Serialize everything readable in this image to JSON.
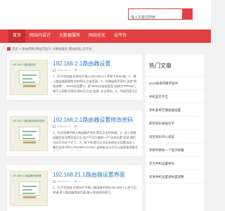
{
  "header": {
    "search_placeholder": "输入关键词搜索"
  },
  "nav": {
    "items": [
      {
        "label": "首页",
        "active": true
      },
      {
        "label": "网站内设计",
        "active": false
      },
      {
        "label": "大数据服务",
        "active": false
      },
      {
        "label": "网站优化",
        "active": false
      },
      {
        "label": "云平台",
        "active": false
      }
    ]
  },
  "breadcrumb": {
    "text": "首页 > 路由网络,网站内设计,大数据服务,网站优化,云平台"
  },
  "articles": [
    {
      "thumb_title": "192.168.2.1路由器设置",
      "title": "192.168.2.1路由器设置",
      "date": "2023-02-17",
      "views": "2",
      "excerpt": "1、打开浏览器,在地址栏输入192.168.2.1,并按下Enter键。2、输入路由器管理账号和密码,点击登录。3、在弹出的页面中,选定\"网络参数\"→\"WAN口设置\"4、把\"WAN口连接类型\"选择为\"PPPoE\"。填写上网账号密码,保存后点击\"连接\",点击保存。5、完成后即可正常使用。"
    },
    {
      "thumb_title": "192.168.2.1路由器设置修改密码",
      "title": "192.168.2.1路由器设置修改密码",
      "date": "2023-02-17",
      "views": "2",
      "excerpt": "1、在浏览器中输入路由器IP地址,然后点击回车键。2、进入到路由器后台设置页面之后,用户们可以看到一个\"无线设置\"选项,我们可以打开这个它了。3、接下来,就可以点击无线安全设置选项,4、最后选择\"WPA-PSK/WPA2-PSK\",这种安全方式可以加密很多数字密码,5、点击保存即可。"
    },
    {
      "thumb_title": "192.168.21.1路由器设置界面",
      "title": "192.168.21.1路由器设置界面",
      "date": "2023-02-17",
      "views": "2",
      "excerpt": "1、打开浏览器,在地址栏中输入路由器IP地址192.168.1.1,按下回车键,进入路由器登录页面,输入登录密码即可。"
    }
  ],
  "sidebar": {
    "title": "热门文章",
    "items": [
      "word表格内数字居中",
      "手机显示不全",
      "手机爱奇艺播放器设置",
      "新年快乐祝福句子",
      "淘宝快乐开心说说",
      "手把手教你一个电子邮箱",
      "华为手机设置呼叫",
      "华清手机设置调色量调整"
    ]
  },
  "colors": {
    "accent": "#e34141",
    "link": "#2d7bc0"
  }
}
